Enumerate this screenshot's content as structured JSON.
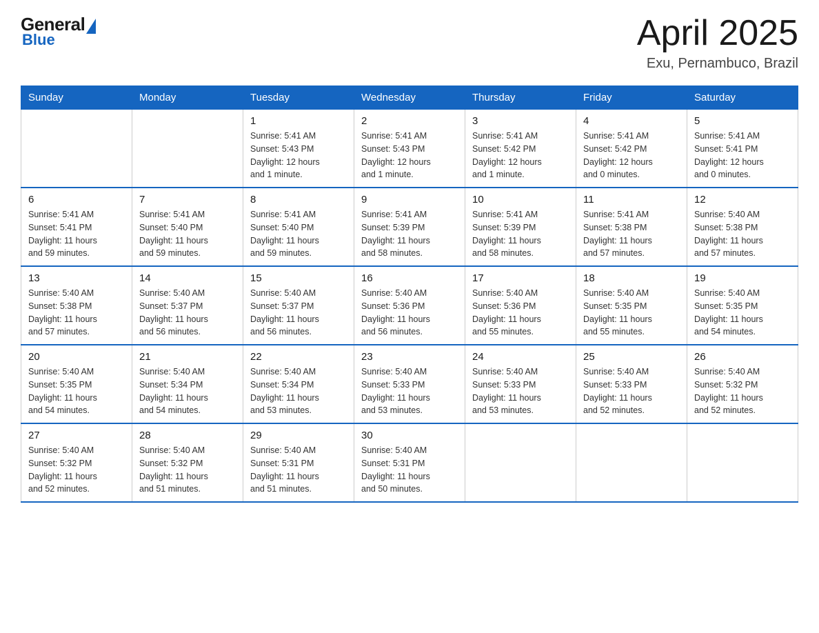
{
  "logo": {
    "general": "General",
    "blue": "Blue"
  },
  "title": {
    "month_year": "April 2025",
    "location": "Exu, Pernambuco, Brazil"
  },
  "weekdays": [
    "Sunday",
    "Monday",
    "Tuesday",
    "Wednesday",
    "Thursday",
    "Friday",
    "Saturday"
  ],
  "weeks": [
    [
      {
        "day": "",
        "info": ""
      },
      {
        "day": "",
        "info": ""
      },
      {
        "day": "1",
        "info": "Sunrise: 5:41 AM\nSunset: 5:43 PM\nDaylight: 12 hours\nand 1 minute."
      },
      {
        "day": "2",
        "info": "Sunrise: 5:41 AM\nSunset: 5:43 PM\nDaylight: 12 hours\nand 1 minute."
      },
      {
        "day": "3",
        "info": "Sunrise: 5:41 AM\nSunset: 5:42 PM\nDaylight: 12 hours\nand 1 minute."
      },
      {
        "day": "4",
        "info": "Sunrise: 5:41 AM\nSunset: 5:42 PM\nDaylight: 12 hours\nand 0 minutes."
      },
      {
        "day": "5",
        "info": "Sunrise: 5:41 AM\nSunset: 5:41 PM\nDaylight: 12 hours\nand 0 minutes."
      }
    ],
    [
      {
        "day": "6",
        "info": "Sunrise: 5:41 AM\nSunset: 5:41 PM\nDaylight: 11 hours\nand 59 minutes."
      },
      {
        "day": "7",
        "info": "Sunrise: 5:41 AM\nSunset: 5:40 PM\nDaylight: 11 hours\nand 59 minutes."
      },
      {
        "day": "8",
        "info": "Sunrise: 5:41 AM\nSunset: 5:40 PM\nDaylight: 11 hours\nand 59 minutes."
      },
      {
        "day": "9",
        "info": "Sunrise: 5:41 AM\nSunset: 5:39 PM\nDaylight: 11 hours\nand 58 minutes."
      },
      {
        "day": "10",
        "info": "Sunrise: 5:41 AM\nSunset: 5:39 PM\nDaylight: 11 hours\nand 58 minutes."
      },
      {
        "day": "11",
        "info": "Sunrise: 5:41 AM\nSunset: 5:38 PM\nDaylight: 11 hours\nand 57 minutes."
      },
      {
        "day": "12",
        "info": "Sunrise: 5:40 AM\nSunset: 5:38 PM\nDaylight: 11 hours\nand 57 minutes."
      }
    ],
    [
      {
        "day": "13",
        "info": "Sunrise: 5:40 AM\nSunset: 5:38 PM\nDaylight: 11 hours\nand 57 minutes."
      },
      {
        "day": "14",
        "info": "Sunrise: 5:40 AM\nSunset: 5:37 PM\nDaylight: 11 hours\nand 56 minutes."
      },
      {
        "day": "15",
        "info": "Sunrise: 5:40 AM\nSunset: 5:37 PM\nDaylight: 11 hours\nand 56 minutes."
      },
      {
        "day": "16",
        "info": "Sunrise: 5:40 AM\nSunset: 5:36 PM\nDaylight: 11 hours\nand 56 minutes."
      },
      {
        "day": "17",
        "info": "Sunrise: 5:40 AM\nSunset: 5:36 PM\nDaylight: 11 hours\nand 55 minutes."
      },
      {
        "day": "18",
        "info": "Sunrise: 5:40 AM\nSunset: 5:35 PM\nDaylight: 11 hours\nand 55 minutes."
      },
      {
        "day": "19",
        "info": "Sunrise: 5:40 AM\nSunset: 5:35 PM\nDaylight: 11 hours\nand 54 minutes."
      }
    ],
    [
      {
        "day": "20",
        "info": "Sunrise: 5:40 AM\nSunset: 5:35 PM\nDaylight: 11 hours\nand 54 minutes."
      },
      {
        "day": "21",
        "info": "Sunrise: 5:40 AM\nSunset: 5:34 PM\nDaylight: 11 hours\nand 54 minutes."
      },
      {
        "day": "22",
        "info": "Sunrise: 5:40 AM\nSunset: 5:34 PM\nDaylight: 11 hours\nand 53 minutes."
      },
      {
        "day": "23",
        "info": "Sunrise: 5:40 AM\nSunset: 5:33 PM\nDaylight: 11 hours\nand 53 minutes."
      },
      {
        "day": "24",
        "info": "Sunrise: 5:40 AM\nSunset: 5:33 PM\nDaylight: 11 hours\nand 53 minutes."
      },
      {
        "day": "25",
        "info": "Sunrise: 5:40 AM\nSunset: 5:33 PM\nDaylight: 11 hours\nand 52 minutes."
      },
      {
        "day": "26",
        "info": "Sunrise: 5:40 AM\nSunset: 5:32 PM\nDaylight: 11 hours\nand 52 minutes."
      }
    ],
    [
      {
        "day": "27",
        "info": "Sunrise: 5:40 AM\nSunset: 5:32 PM\nDaylight: 11 hours\nand 52 minutes."
      },
      {
        "day": "28",
        "info": "Sunrise: 5:40 AM\nSunset: 5:32 PM\nDaylight: 11 hours\nand 51 minutes."
      },
      {
        "day": "29",
        "info": "Sunrise: 5:40 AM\nSunset: 5:31 PM\nDaylight: 11 hours\nand 51 minutes."
      },
      {
        "day": "30",
        "info": "Sunrise: 5:40 AM\nSunset: 5:31 PM\nDaylight: 11 hours\nand 50 minutes."
      },
      {
        "day": "",
        "info": ""
      },
      {
        "day": "",
        "info": ""
      },
      {
        "day": "",
        "info": ""
      }
    ]
  ]
}
